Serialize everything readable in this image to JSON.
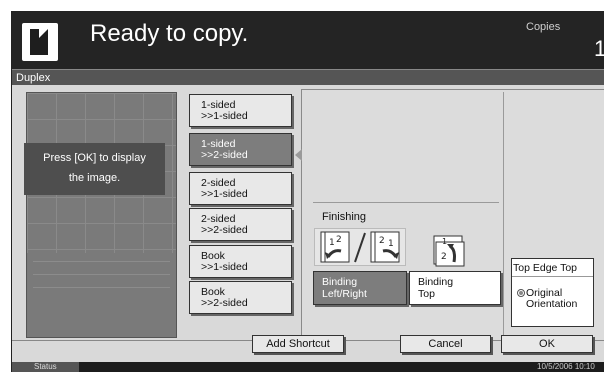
{
  "header": {
    "status_message": "Ready to copy.",
    "copies_label": "Copies",
    "copies_value": "1"
  },
  "titlebar": {
    "title": "Duplex"
  },
  "preview": {
    "message_line1": "Press [OK] to display",
    "message_line2": "the image."
  },
  "duplex_options": [
    {
      "line1": "1-sided",
      "line2": ">>1-sided",
      "selected": false
    },
    {
      "line1": "1-sided",
      "line2": ">>2-sided",
      "selected": true
    },
    {
      "line1": "2-sided",
      "line2": ">>1-sided",
      "selected": false
    },
    {
      "line1": "2-sided",
      "line2": ">>2-sided",
      "selected": false
    },
    {
      "line1": "Book",
      "line2": ">>1-sided",
      "selected": false
    },
    {
      "line1": "Book",
      "line2": ">>2-sided",
      "selected": false
    }
  ],
  "finishing": {
    "label": "Finishing",
    "binding_lr": {
      "line1": "Binding",
      "line2": "Left/Right",
      "selected": true
    },
    "binding_top": {
      "line1": "Binding",
      "line2": "Top",
      "selected": false
    }
  },
  "orientation": {
    "top_edge": "Top Edge Top",
    "original_line1": "Original",
    "original_line2": "Orientation"
  },
  "buttons": {
    "add_shortcut": "Add Shortcut",
    "cancel": "Cancel",
    "ok": "OK"
  },
  "statusbar": {
    "status_label": "Status",
    "datetime": "10/5/2006   10:10"
  },
  "colors": {
    "header_bg": "#242424",
    "selected_bg": "#7d7d7d",
    "panel_bg": "#dcdcdc"
  }
}
